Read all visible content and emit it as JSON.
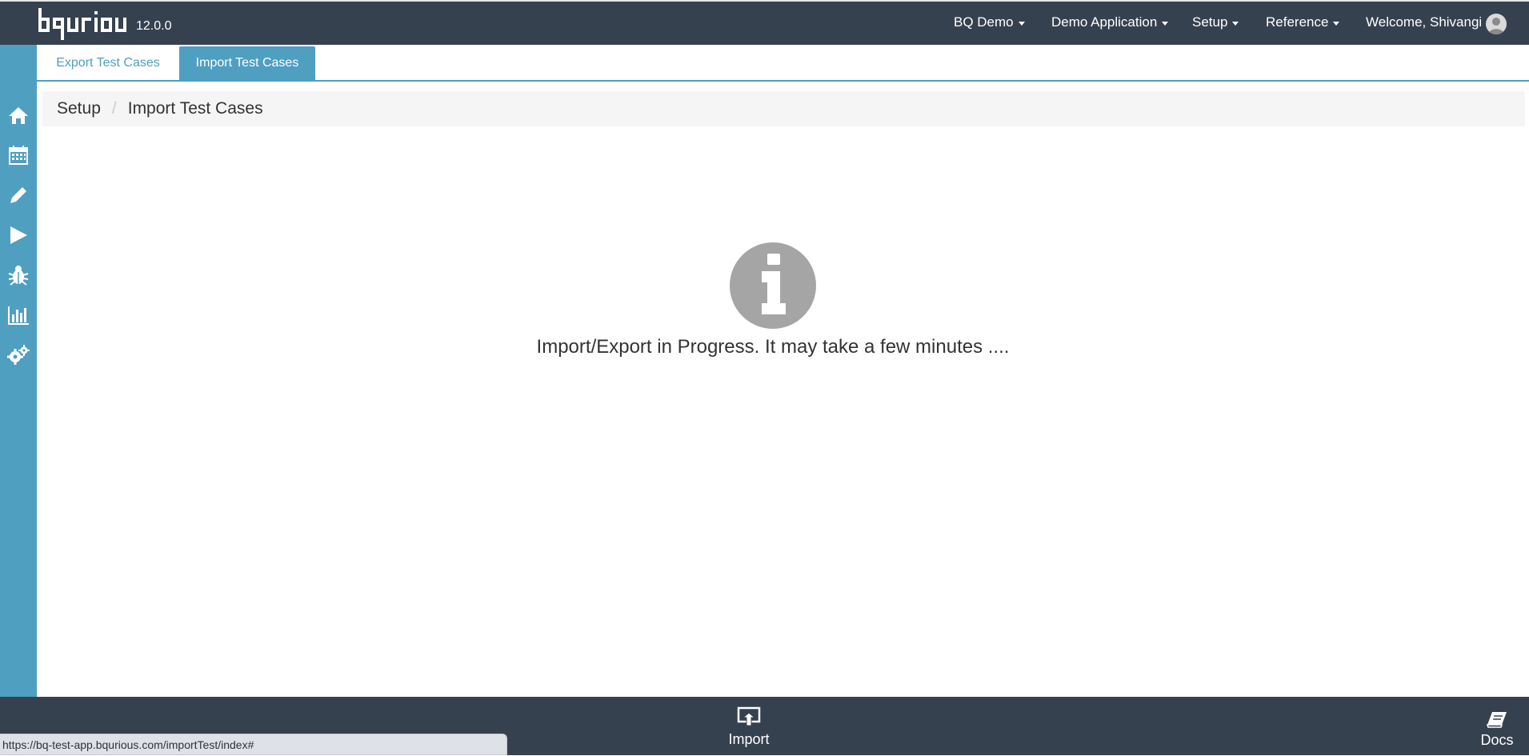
{
  "header": {
    "version": "12.0.0",
    "logo_text": "bqurious",
    "nav": [
      "BQ Demo",
      "Demo Application",
      "Setup",
      "Reference"
    ],
    "welcome": "Welcome, Shivangi"
  },
  "sidebar": {
    "icons": [
      "home-icon",
      "calendar-icon",
      "pencil-icon",
      "play-icon",
      "bug-icon",
      "bar-chart-icon",
      "gears-icon"
    ]
  },
  "tabs": {
    "export": "Export Test Cases",
    "import": "Import Test Cases"
  },
  "breadcrumb": {
    "root": "Setup",
    "separator": "/",
    "current": "Import Test Cases"
  },
  "message": {
    "text": "Import/Export in Progress. It may take a few minutes ...."
  },
  "footer": {
    "import_label": "Import",
    "docs_label": "Docs"
  },
  "status_bar": {
    "url": "https://bq-test-app.bqurious.com/importTest/index#"
  },
  "colors": {
    "navbar": "#364150",
    "accent": "#4f9fc1",
    "info_icon": "#a5a5a5"
  }
}
